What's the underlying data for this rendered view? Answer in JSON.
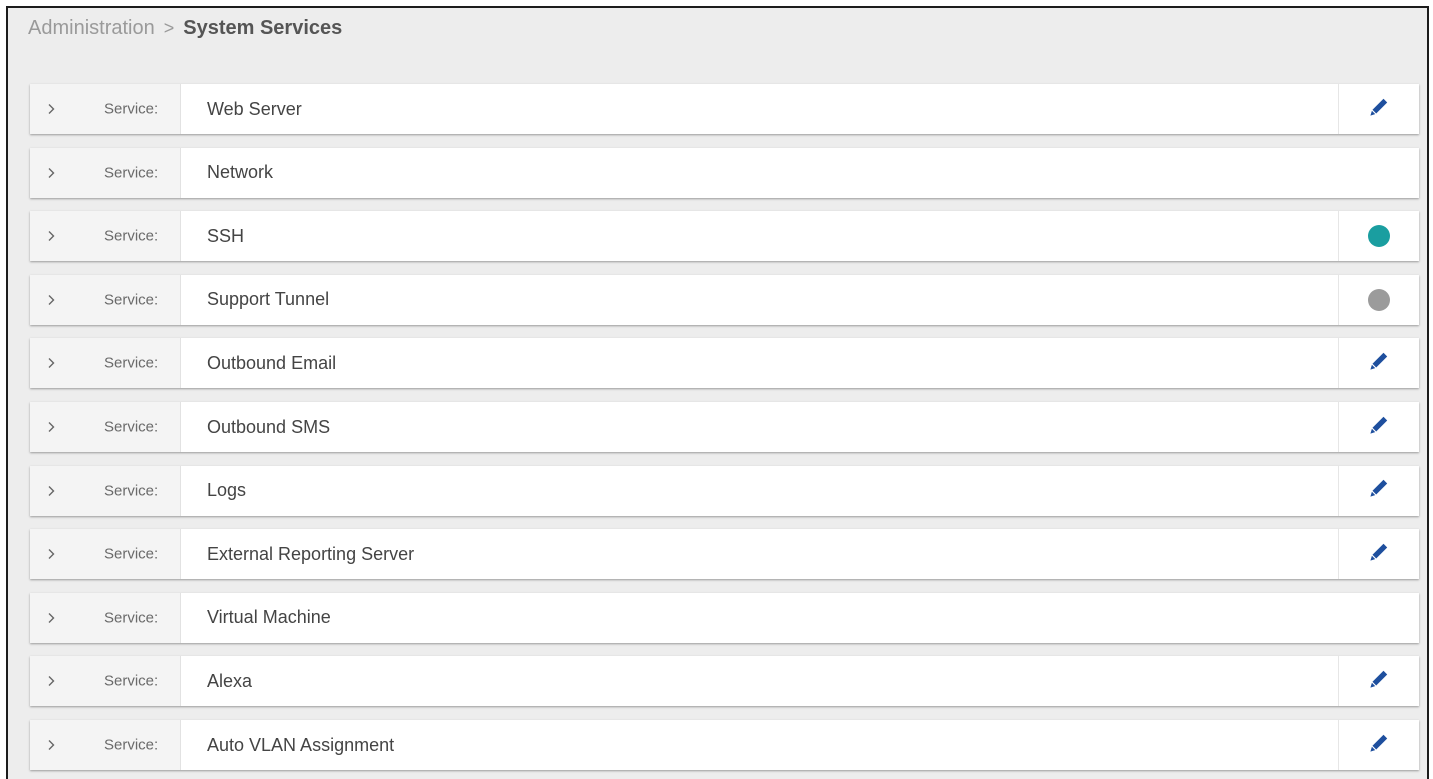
{
  "breadcrumb": {
    "parent": "Administration",
    "separator": ">",
    "current": "System Services"
  },
  "colors": {
    "edit_icon": "#1e4f9e",
    "status_on": "#1a9ea0",
    "status_off": "#9b9b9b"
  },
  "services": [
    {
      "label": "Service:",
      "name": "Web Server",
      "action": "edit"
    },
    {
      "label": "Service:",
      "name": "Network",
      "action": "none"
    },
    {
      "label": "Service:",
      "name": "SSH",
      "action": "status-on"
    },
    {
      "label": "Service:",
      "name": "Support Tunnel",
      "action": "status-off"
    },
    {
      "label": "Service:",
      "name": "Outbound Email",
      "action": "edit"
    },
    {
      "label": "Service:",
      "name": "Outbound SMS",
      "action": "edit"
    },
    {
      "label": "Service:",
      "name": "Logs",
      "action": "edit"
    },
    {
      "label": "Service:",
      "name": "External Reporting Server",
      "action": "edit"
    },
    {
      "label": "Service:",
      "name": "Virtual Machine",
      "action": "none"
    },
    {
      "label": "Service:",
      "name": "Alexa",
      "action": "edit"
    },
    {
      "label": "Service:",
      "name": "Auto VLAN Assignment",
      "action": "edit"
    }
  ]
}
